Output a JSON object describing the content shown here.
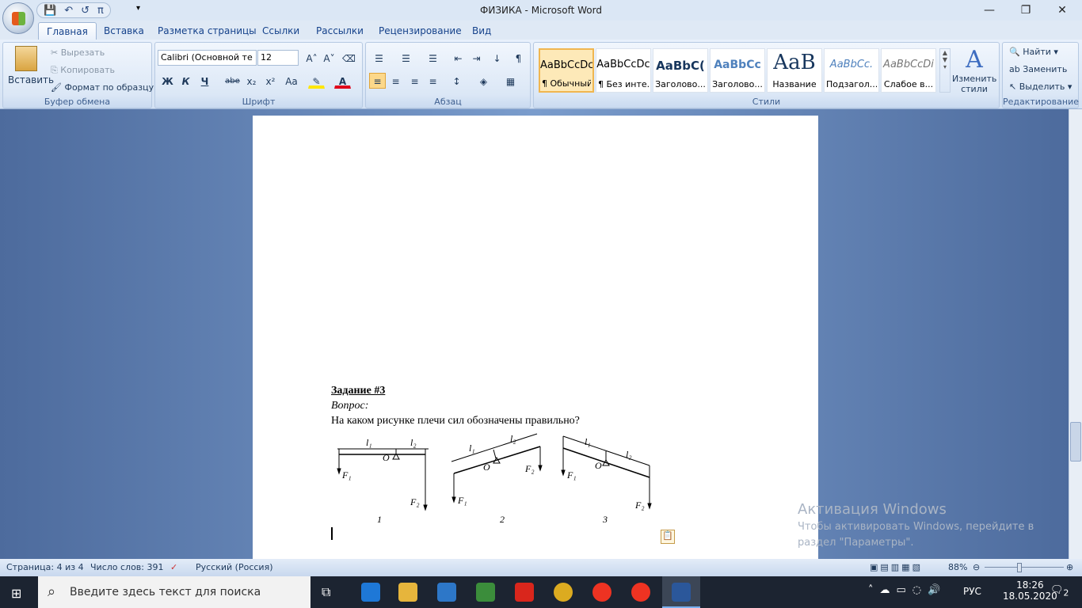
{
  "window": {
    "title": "ФИЗИКА - Microsoft Word"
  },
  "qat": {
    "save": "💾",
    "undo": "↶",
    "redo": "↺",
    "pi": "π",
    "more": "▾"
  },
  "tabs": [
    "Главная",
    "Вставка",
    "Разметка страницы",
    "Ссылки",
    "Рассылки",
    "Рецензирование",
    "Вид"
  ],
  "clipboard": {
    "paste": "Вставить",
    "cut": "Вырезать",
    "copy": "Копировать",
    "format_painter": "Формат по образцу",
    "label": "Буфер обмена"
  },
  "font": {
    "name": "Calibri (Основной те",
    "size": "12",
    "label": "Шрифт",
    "bold": "Ж",
    "italic": "К",
    "underline": "Ч",
    "strike": "abe",
    "sub": "x₂",
    "sup": "x²",
    "case": "Aa",
    "grow": "A˄",
    "shrink": "A˅"
  },
  "paragraph": {
    "label": "Абзац"
  },
  "styles": {
    "label": "Стили",
    "items": [
      {
        "sample": "AaBbCcDc",
        "name": "¶ Обычный"
      },
      {
        "sample": "AaBbCcDc",
        "name": "¶ Без инте..."
      },
      {
        "sample": "AaBbC(",
        "name": "Заголово..."
      },
      {
        "sample": "AaBbCc",
        "name": "Заголово..."
      },
      {
        "sample": "AaB",
        "name": "Название"
      },
      {
        "sample": "AaBbCc.",
        "name": "Подзагол..."
      },
      {
        "sample": "AaBbCcDi",
        "name": "Слабое в..."
      }
    ],
    "change": "Изменить стили"
  },
  "editing": {
    "label": "Редактирование",
    "find": "Найти",
    "replace": "Заменить",
    "select": "Выделить"
  },
  "document": {
    "heading": "Задание #3",
    "question_label": "Вопрос:",
    "question": "На каком рисунке плечи сил обозначены правильно?",
    "figure_labels": {
      "l1": "l₁",
      "l2": "l₂",
      "O": "O",
      "F1": "F₁",
      "F2": "F₂"
    },
    "figure_numbers": [
      "1",
      "2",
      "3"
    ]
  },
  "watermark": {
    "title": "Активация Windows",
    "line1": "Чтобы активировать Windows, перейдите в",
    "line2": "раздел \"Параметры\"."
  },
  "status": {
    "page": "Страница: 4 из 4",
    "words": "Число слов: 391",
    "language": "Русский (Россия)",
    "zoom": "88%",
    "zoom_level": 88
  },
  "taskbar": {
    "search_placeholder": "Введите здесь текст для поиска",
    "lang": "РУС",
    "time": "18:26",
    "date": "18.05.2020",
    "notifications": "2"
  }
}
